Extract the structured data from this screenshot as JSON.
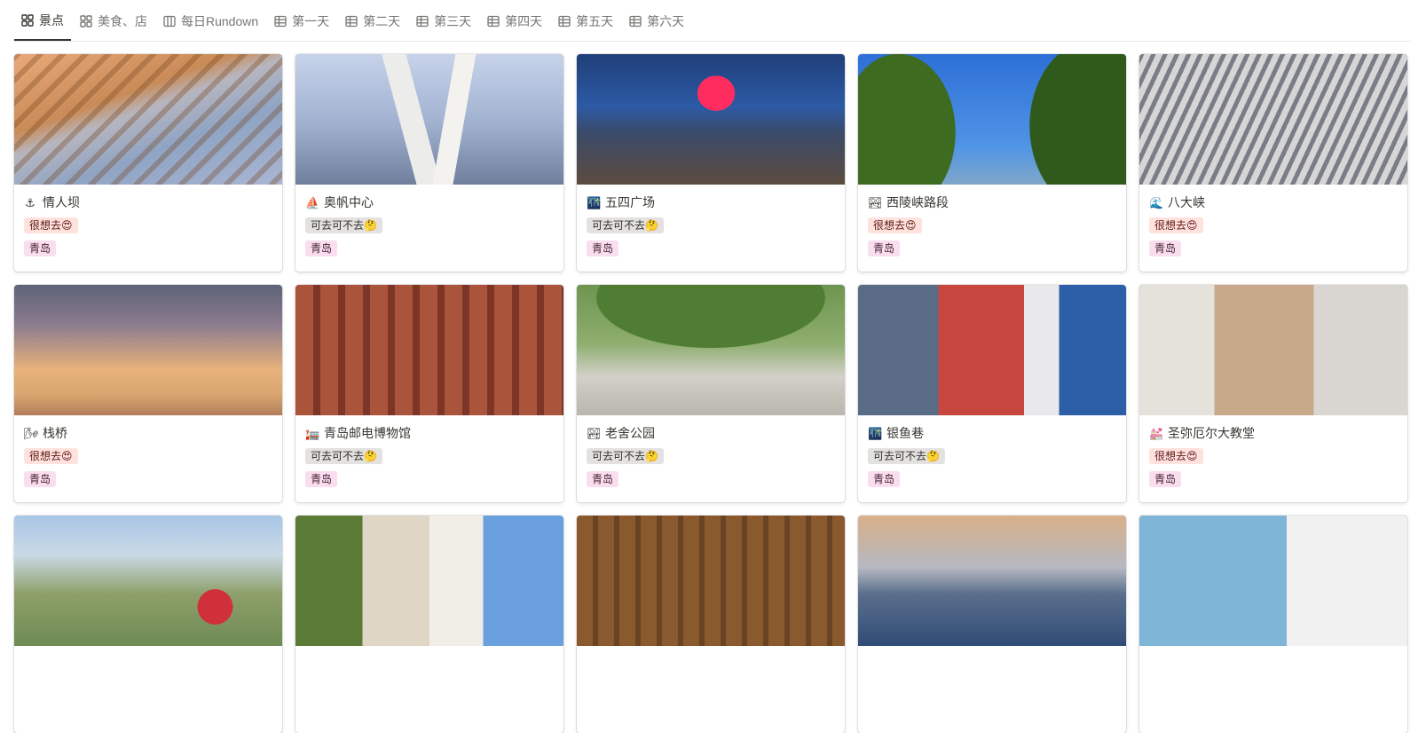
{
  "tabs": [
    {
      "label": "景点",
      "icon": "gallery-icon",
      "active": true
    },
    {
      "label": "美食、店",
      "icon": "gallery-icon",
      "active": false
    },
    {
      "label": "每日Rundown",
      "icon": "board-icon",
      "active": false
    },
    {
      "label": "第一天",
      "icon": "table-icon",
      "active": false
    },
    {
      "label": "第二天",
      "icon": "table-icon",
      "active": false
    },
    {
      "label": "第三天",
      "icon": "table-icon",
      "active": false
    },
    {
      "label": "第四天",
      "icon": "table-icon",
      "active": false
    },
    {
      "label": "第五天",
      "icon": "table-icon",
      "active": false
    },
    {
      "label": "第六天",
      "icon": "table-icon",
      "active": false
    }
  ],
  "tag_styles": {
    "很想去😍": {
      "bg": "#ffe2dd",
      "fg": "#5d1715"
    },
    "可去可不去🤔": {
      "bg": "#e3e2e0",
      "fg": "#32302c"
    },
    "青岛": {
      "bg": "#f8deee",
      "fg": "#4c2337"
    }
  },
  "cards": [
    {
      "emoji": "⚓",
      "title": "情人坝",
      "want": "很想去😍",
      "city": "青岛",
      "cover": "breakwater"
    },
    {
      "emoji": "⛵",
      "title": "奥帆中心",
      "want": "可去可不去🤔",
      "city": "青岛",
      "cover": "marina"
    },
    {
      "emoji": "🌃",
      "title": "五四广场",
      "want": "可去可不去🤔",
      "city": "青岛",
      "cover": "nightplaza"
    },
    {
      "emoji": "🏞",
      "title": "西陵峡路段",
      "want": "很想去😍",
      "city": "青岛",
      "cover": "trees"
    },
    {
      "emoji": "🌊",
      "title": "八大峡",
      "want": "很想去😍",
      "city": "青岛",
      "cover": "aerial"
    },
    {
      "emoji": "🌬",
      "title": "栈桥",
      "want": "很想去😍",
      "city": "青岛",
      "cover": "pavilion"
    },
    {
      "emoji": "🏣",
      "title": "青岛邮电博物馆",
      "want": "可去可不去🤔",
      "city": "青岛",
      "cover": "redbuilding"
    },
    {
      "emoji": "🏞",
      "title": "老舍公园",
      "want": "可去可不去🤔",
      "city": "青岛",
      "cover": "park"
    },
    {
      "emoji": "🌃",
      "title": "银鱼巷",
      "want": "可去可不去🤔",
      "city": "青岛",
      "cover": "billboards"
    },
    {
      "emoji": "💒",
      "title": "圣弥厄尔大教堂",
      "want": "很想去😍",
      "city": "青岛",
      "cover": "cathedral"
    },
    {
      "emoji": "",
      "title": "",
      "want": "",
      "city": "",
      "cover": "cityview"
    },
    {
      "emoji": "",
      "title": "",
      "want": "",
      "city": "",
      "cover": "street"
    },
    {
      "emoji": "",
      "title": "",
      "want": "",
      "city": "",
      "cover": "eaves"
    },
    {
      "emoji": "",
      "title": "",
      "want": "",
      "city": "",
      "cover": "lighthouse"
    },
    {
      "emoji": "",
      "title": "",
      "want": "",
      "city": "",
      "cover": "redroof"
    }
  ]
}
